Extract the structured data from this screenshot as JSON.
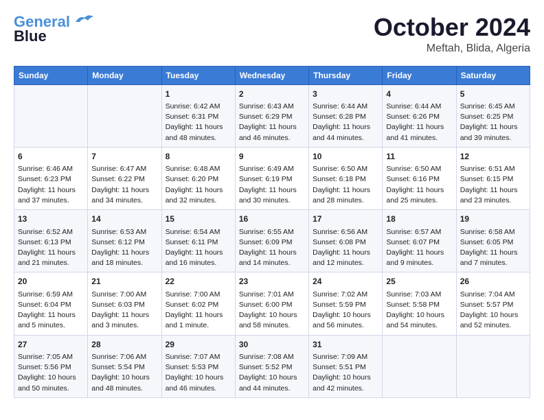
{
  "header": {
    "logo_line1": "General",
    "logo_line2": "Blue",
    "month": "October 2024",
    "location": "Meftah, Blida, Algeria"
  },
  "weekdays": [
    "Sunday",
    "Monday",
    "Tuesday",
    "Wednesday",
    "Thursday",
    "Friday",
    "Saturday"
  ],
  "weeks": [
    [
      {
        "day": "",
        "info": ""
      },
      {
        "day": "",
        "info": ""
      },
      {
        "day": "1",
        "info": "Sunrise: 6:42 AM\nSunset: 6:31 PM\nDaylight: 11 hours and 48 minutes."
      },
      {
        "day": "2",
        "info": "Sunrise: 6:43 AM\nSunset: 6:29 PM\nDaylight: 11 hours and 46 minutes."
      },
      {
        "day": "3",
        "info": "Sunrise: 6:44 AM\nSunset: 6:28 PM\nDaylight: 11 hours and 44 minutes."
      },
      {
        "day": "4",
        "info": "Sunrise: 6:44 AM\nSunset: 6:26 PM\nDaylight: 11 hours and 41 minutes."
      },
      {
        "day": "5",
        "info": "Sunrise: 6:45 AM\nSunset: 6:25 PM\nDaylight: 11 hours and 39 minutes."
      }
    ],
    [
      {
        "day": "6",
        "info": "Sunrise: 6:46 AM\nSunset: 6:23 PM\nDaylight: 11 hours and 37 minutes."
      },
      {
        "day": "7",
        "info": "Sunrise: 6:47 AM\nSunset: 6:22 PM\nDaylight: 11 hours and 34 minutes."
      },
      {
        "day": "8",
        "info": "Sunrise: 6:48 AM\nSunset: 6:20 PM\nDaylight: 11 hours and 32 minutes."
      },
      {
        "day": "9",
        "info": "Sunrise: 6:49 AM\nSunset: 6:19 PM\nDaylight: 11 hours and 30 minutes."
      },
      {
        "day": "10",
        "info": "Sunrise: 6:50 AM\nSunset: 6:18 PM\nDaylight: 11 hours and 28 minutes."
      },
      {
        "day": "11",
        "info": "Sunrise: 6:50 AM\nSunset: 6:16 PM\nDaylight: 11 hours and 25 minutes."
      },
      {
        "day": "12",
        "info": "Sunrise: 6:51 AM\nSunset: 6:15 PM\nDaylight: 11 hours and 23 minutes."
      }
    ],
    [
      {
        "day": "13",
        "info": "Sunrise: 6:52 AM\nSunset: 6:13 PM\nDaylight: 11 hours and 21 minutes."
      },
      {
        "day": "14",
        "info": "Sunrise: 6:53 AM\nSunset: 6:12 PM\nDaylight: 11 hours and 18 minutes."
      },
      {
        "day": "15",
        "info": "Sunrise: 6:54 AM\nSunset: 6:11 PM\nDaylight: 11 hours and 16 minutes."
      },
      {
        "day": "16",
        "info": "Sunrise: 6:55 AM\nSunset: 6:09 PM\nDaylight: 11 hours and 14 minutes."
      },
      {
        "day": "17",
        "info": "Sunrise: 6:56 AM\nSunset: 6:08 PM\nDaylight: 11 hours and 12 minutes."
      },
      {
        "day": "18",
        "info": "Sunrise: 6:57 AM\nSunset: 6:07 PM\nDaylight: 11 hours and 9 minutes."
      },
      {
        "day": "19",
        "info": "Sunrise: 6:58 AM\nSunset: 6:05 PM\nDaylight: 11 hours and 7 minutes."
      }
    ],
    [
      {
        "day": "20",
        "info": "Sunrise: 6:59 AM\nSunset: 6:04 PM\nDaylight: 11 hours and 5 minutes."
      },
      {
        "day": "21",
        "info": "Sunrise: 7:00 AM\nSunset: 6:03 PM\nDaylight: 11 hours and 3 minutes."
      },
      {
        "day": "22",
        "info": "Sunrise: 7:00 AM\nSunset: 6:02 PM\nDaylight: 11 hours and 1 minute."
      },
      {
        "day": "23",
        "info": "Sunrise: 7:01 AM\nSunset: 6:00 PM\nDaylight: 10 hours and 58 minutes."
      },
      {
        "day": "24",
        "info": "Sunrise: 7:02 AM\nSunset: 5:59 PM\nDaylight: 10 hours and 56 minutes."
      },
      {
        "day": "25",
        "info": "Sunrise: 7:03 AM\nSunset: 5:58 PM\nDaylight: 10 hours and 54 minutes."
      },
      {
        "day": "26",
        "info": "Sunrise: 7:04 AM\nSunset: 5:57 PM\nDaylight: 10 hours and 52 minutes."
      }
    ],
    [
      {
        "day": "27",
        "info": "Sunrise: 7:05 AM\nSunset: 5:56 PM\nDaylight: 10 hours and 50 minutes."
      },
      {
        "day": "28",
        "info": "Sunrise: 7:06 AM\nSunset: 5:54 PM\nDaylight: 10 hours and 48 minutes."
      },
      {
        "day": "29",
        "info": "Sunrise: 7:07 AM\nSunset: 5:53 PM\nDaylight: 10 hours and 46 minutes."
      },
      {
        "day": "30",
        "info": "Sunrise: 7:08 AM\nSunset: 5:52 PM\nDaylight: 10 hours and 44 minutes."
      },
      {
        "day": "31",
        "info": "Sunrise: 7:09 AM\nSunset: 5:51 PM\nDaylight: 10 hours and 42 minutes."
      },
      {
        "day": "",
        "info": ""
      },
      {
        "day": "",
        "info": ""
      }
    ]
  ]
}
